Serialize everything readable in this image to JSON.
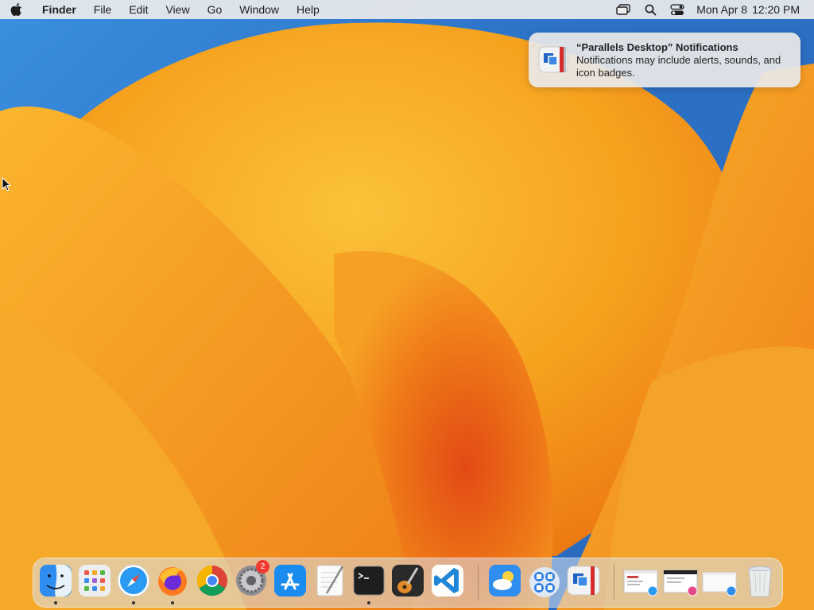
{
  "menubar": {
    "app_name": "Finder",
    "menus": [
      "File",
      "Edit",
      "View",
      "Go",
      "Window",
      "Help"
    ],
    "date": "Mon Apr 8",
    "time": "12:20 PM",
    "status_icons": [
      "screen-mirroring-icon",
      "spotlight-search-icon",
      "control-center-icon"
    ]
  },
  "notification": {
    "title": "“Parallels Desktop” Notifications",
    "body": "Notifications may include alerts, sounds, and icon badges.",
    "app_icon": "parallels-desktop-icon"
  },
  "dock": {
    "apps": [
      {
        "name": "Finder",
        "running": true
      },
      {
        "name": "Launchpad",
        "running": false
      },
      {
        "name": "Safari",
        "running": true
      },
      {
        "name": "Firefox",
        "running": true
      },
      {
        "name": "Google Chrome",
        "running": false
      },
      {
        "name": "System Settings",
        "running": false,
        "badge": "2"
      },
      {
        "name": "App Store",
        "running": false
      },
      {
        "name": "TextEdit",
        "running": false
      },
      {
        "name": "Terminal",
        "running": true
      },
      {
        "name": "GarageBand",
        "running": false
      },
      {
        "name": "Visual Studio Code",
        "running": false
      },
      {
        "name": "Weather",
        "running": false
      },
      {
        "name": "Parallels Desktop Control Center",
        "running": false
      },
      {
        "name": "Parallels Desktop",
        "running": false
      }
    ],
    "minimized": [
      "Safari window",
      "Photos window",
      "Finder window"
    ],
    "trash": "Trash"
  },
  "colors": {
    "wallpaper_orange": "#f5a21e",
    "wallpaper_blue": "#2d73c8",
    "badge_red": "#f23a32"
  }
}
